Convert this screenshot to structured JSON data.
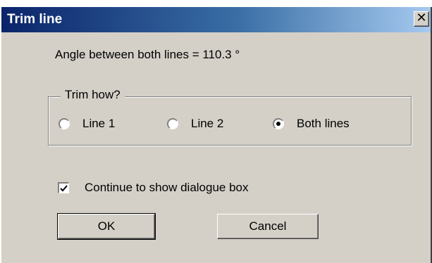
{
  "window": {
    "title": "Trim line",
    "close_glyph": "✕"
  },
  "angle_text": "Angle between both lines = 110.3 °",
  "trim_group": {
    "legend": "Trim how?",
    "options": [
      {
        "label": "Line 1",
        "checked": false
      },
      {
        "label": "Line 2",
        "checked": false
      },
      {
        "label": "Both lines",
        "checked": true
      }
    ]
  },
  "continue_checkbox": {
    "label": "Continue to show dialogue box",
    "checked": true
  },
  "buttons": {
    "ok_label": "OK",
    "cancel_label": "Cancel"
  }
}
